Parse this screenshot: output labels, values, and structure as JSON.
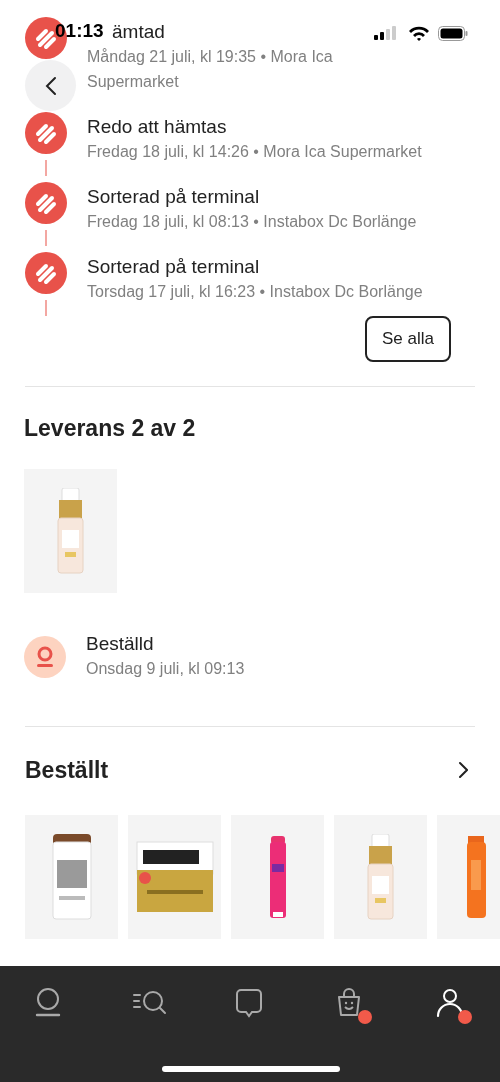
{
  "status_bar": {
    "time": "01:13"
  },
  "timeline": [
    {
      "title": "ämtad",
      "subtitle": "Måndag 21 juli, kl 19:35 • Mora Ica Supermarket"
    },
    {
      "title": "Redo att hämtas",
      "subtitle": "Fredag 18 juli, kl 14:26 • Mora Ica Supermarket"
    },
    {
      "title": "Sorterad på terminal",
      "subtitle": "Fredag 18 juli, kl 08:13 • Instabox Dc Borlänge"
    },
    {
      "title": "Sorterad på terminal",
      "subtitle": "Torsdag 17 juli, kl 16:23 • Instabox Dc Borlänge"
    }
  ],
  "see_all_button": {
    "label": "Se alla"
  },
  "delivery": {
    "heading": "Leverans 2 av 2",
    "status": {
      "title": "Beställd",
      "subtitle": "Onsdag 9 juli, kl 09:13"
    }
  },
  "ordered": {
    "heading": "Beställt"
  },
  "tab_bar": [
    {
      "kind": "home",
      "selected": false,
      "notification": false
    },
    {
      "kind": "search",
      "selected": false,
      "notification": false
    },
    {
      "kind": "chat",
      "selected": false,
      "notification": false
    },
    {
      "kind": "bag",
      "selected": false,
      "notification": true
    },
    {
      "kind": "profile",
      "selected": true,
      "notification": true
    }
  ]
}
